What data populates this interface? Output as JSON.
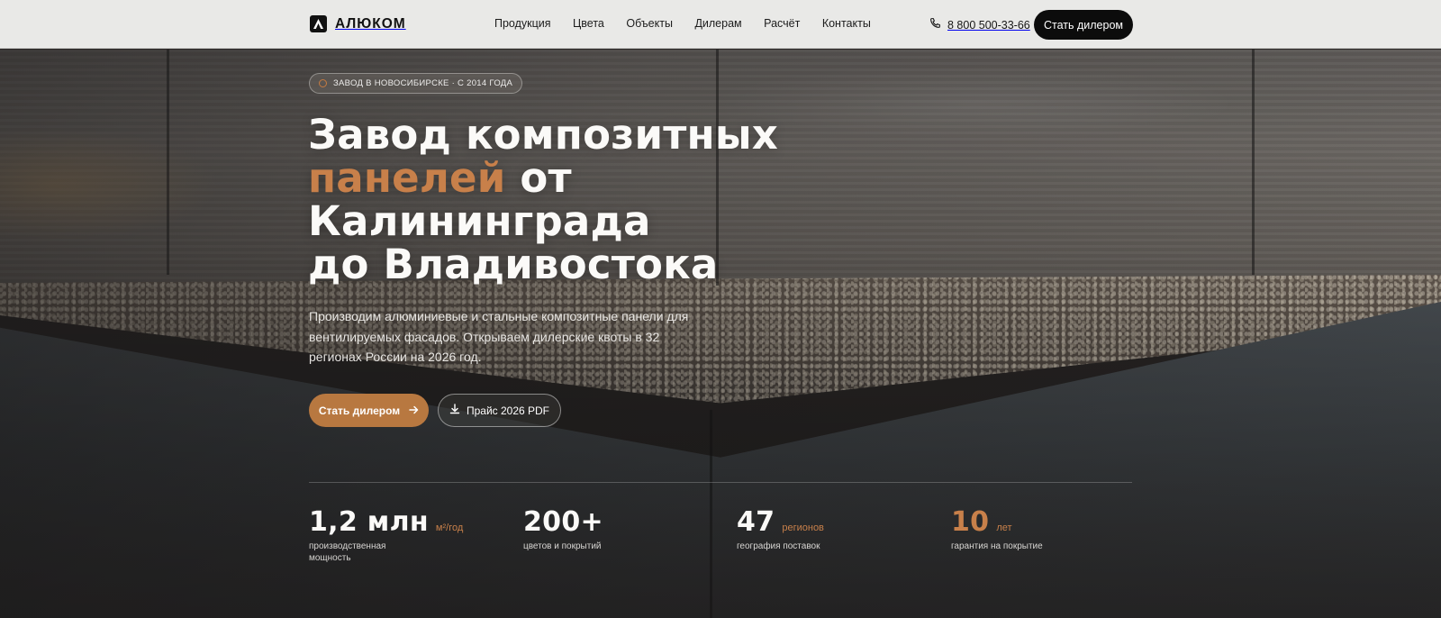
{
  "brand": {
    "name": "АЛЮКОМ"
  },
  "nav": {
    "items": [
      "Продукция",
      "Цвета",
      "Объекты",
      "Дилерам",
      "Расчёт",
      "Контакты"
    ]
  },
  "header": {
    "phone": "8 800 500-33-66",
    "cta_label": "Стать дилером"
  },
  "hero": {
    "badge": "ЗАВОД В НОВОСИБИРСКЕ · С 2014 ГОДА",
    "title_line1": "Завод композитных",
    "title_accent": "панелей",
    "title_line2_rest": " от",
    "title_line3": "Калининграда",
    "title_line4": "до Владивостока",
    "lead": "Производим алюминиевые и стальные композитные панели для вентилируемых фасадов. Открываем дилерские квоты в 32 регионах России на 2026 год.",
    "primary_label": "Стать дилером",
    "secondary_label": "Прайс 2026 PDF"
  },
  "stats": [
    {
      "value": "1,2 млн",
      "unit": "м²/год",
      "caption": "производственная мощность"
    },
    {
      "value": "200+",
      "unit": "",
      "caption": "цветов и покрытий"
    },
    {
      "value": "47",
      "unit": "регионов",
      "caption": "география поставок"
    },
    {
      "value": "10",
      "unit": "лет",
      "caption": "гарантия на покрытие"
    }
  ],
  "colors": {
    "accent": "#c8804a",
    "button_accent": "#b87840",
    "dark": "#0c0c0c"
  }
}
